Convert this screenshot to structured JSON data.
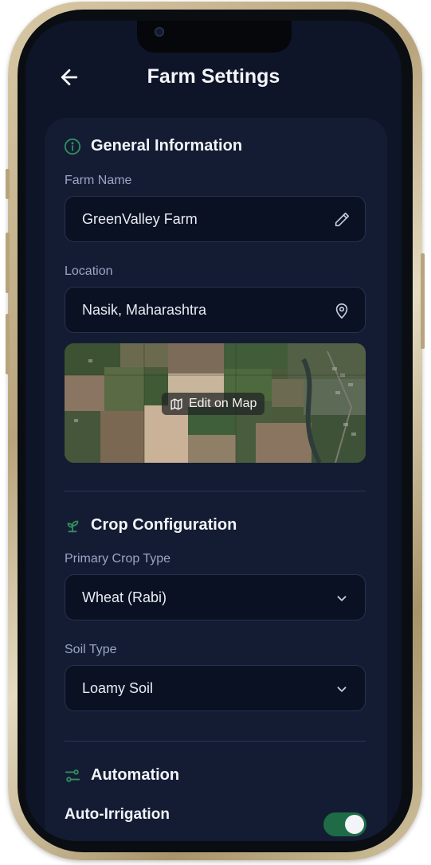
{
  "header": {
    "title": "Farm Settings"
  },
  "general": {
    "title": "General Information",
    "farm_name_label": "Farm Name",
    "farm_name_value": "GreenValley Farm",
    "location_label": "Location",
    "location_value": "Nasik, Maharashtra",
    "map_button": "Edit on Map"
  },
  "crop": {
    "title": "Crop Configuration",
    "primary_crop_label": "Primary Crop Type",
    "primary_crop_value": "Wheat (Rabi)",
    "soil_label": "Soil Type",
    "soil_value": "Loamy Soil"
  },
  "automation": {
    "title": "Automation",
    "auto_irrigation_label": "Auto-Irrigation",
    "auto_irrigation_on": true
  },
  "colors": {
    "background": "#0e1528",
    "card": "#141c33",
    "accent_green": "#2f8f5f",
    "toggle_on": "#1e6b45",
    "label": "#9aa6c3",
    "field_bg": "#0a1122"
  },
  "icons": {
    "back": "arrow-left-icon",
    "general": "info-icon",
    "farm_name": "pencil-icon",
    "location": "map-pin-icon",
    "map_button": "map-icon",
    "crop": "sprout-icon",
    "dropdown": "chevron-down-icon",
    "automation": "sliders-icon"
  }
}
